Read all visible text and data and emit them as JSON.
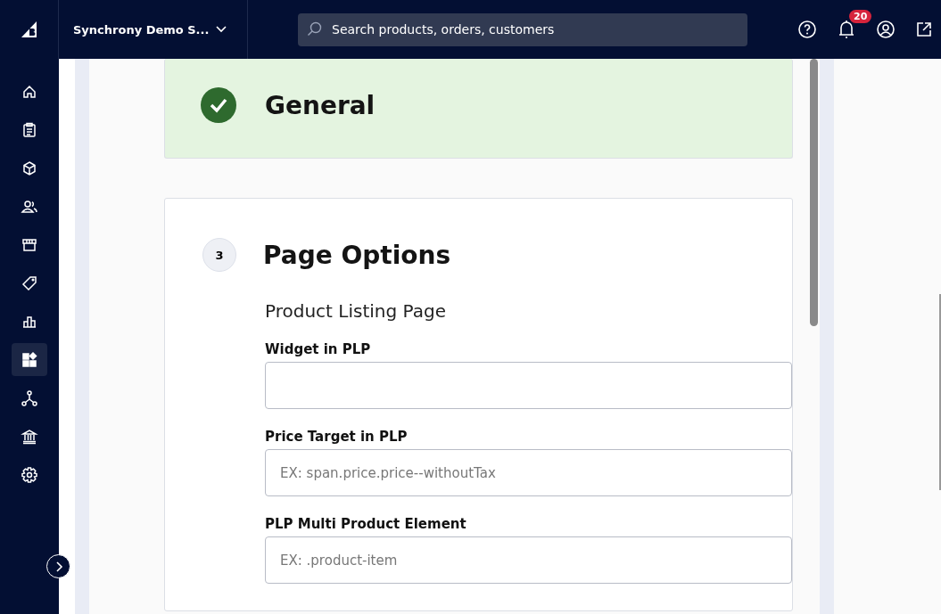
{
  "topbar": {
    "store_name": "Synchrony Demo S...",
    "search": {
      "placeholder": "Search products, orders, customers"
    },
    "notification_count": "20"
  },
  "sidebar": {
    "items": [
      {
        "selected": false
      },
      {
        "selected": false
      },
      {
        "selected": false
      },
      {
        "selected": false
      },
      {
        "selected": false
      },
      {
        "selected": false
      },
      {
        "selected": false
      },
      {
        "selected": true
      },
      {
        "selected": false
      },
      {
        "selected": false
      },
      {
        "selected": false
      }
    ]
  },
  "steps": [
    {
      "kind": "done",
      "title": "General"
    },
    {
      "kind": "number",
      "number": "3",
      "title": "Page Options",
      "subtitle": "Product Listing Page",
      "fields": [
        {
          "label": "Widget in PLP"
        },
        {
          "label": "Price Target in PLP",
          "placeholder": "EX: span.price.price--withoutTax"
        },
        {
          "label": "PLP Multi Product Element",
          "placeholder": "EX: .product-item"
        }
      ]
    }
  ]
}
